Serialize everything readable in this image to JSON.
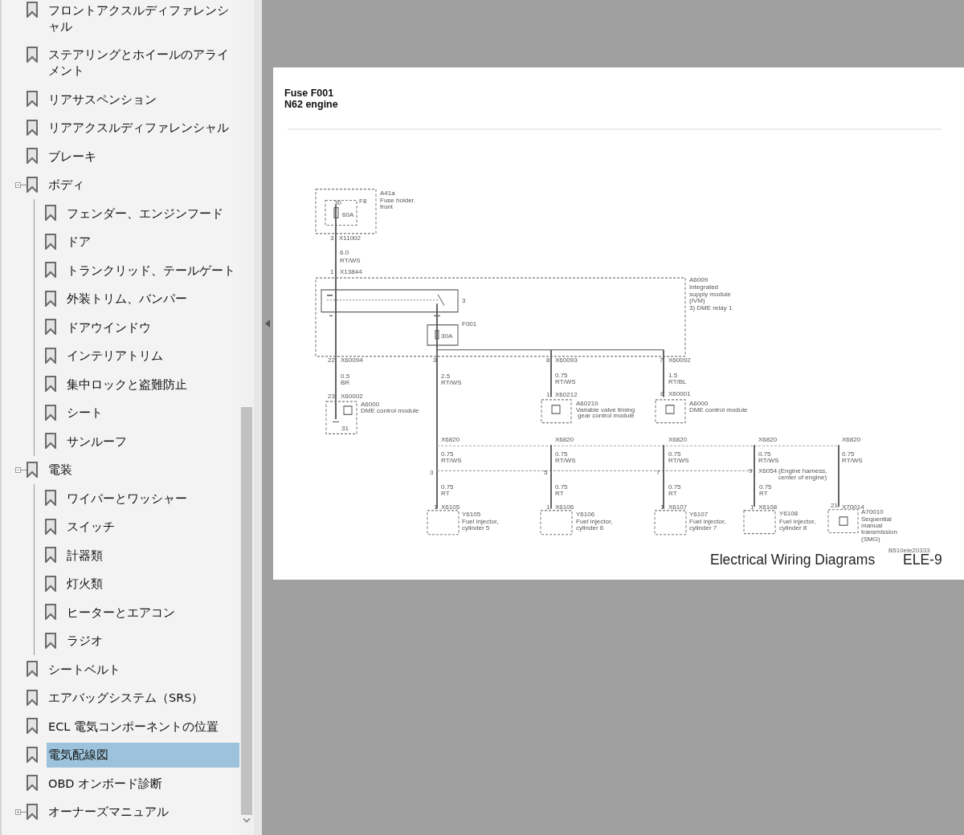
{
  "sidebar": {
    "items": [
      {
        "label": "フロントアクスルディファレンシャル",
        "selected": false
      },
      {
        "label": "ステアリングとホイールのアライメント",
        "selected": false
      },
      {
        "label": "リアサスペンション",
        "selected": false
      },
      {
        "label": "リアアクスルディファレンシャル",
        "selected": false
      },
      {
        "label": "ブレーキ",
        "selected": false
      },
      {
        "label": "ボディ",
        "selected": false,
        "expanded": true,
        "children": [
          {
            "label": "フェンダー、エンジンフード",
            "selected": false
          },
          {
            "label": "ドア",
            "selected": false
          },
          {
            "label": "トランクリッド、テールゲート",
            "selected": false
          },
          {
            "label": "外装トリム、バンパー",
            "selected": false
          },
          {
            "label": "ドアウインドウ",
            "selected": false
          },
          {
            "label": "インテリアトリム",
            "selected": false
          },
          {
            "label": "集中ロックと盗難防止",
            "selected": false
          },
          {
            "label": "シート",
            "selected": false
          },
          {
            "label": "サンルーフ",
            "selected": false
          }
        ]
      },
      {
        "label": "電装",
        "selected": false,
        "expanded": true,
        "children": [
          {
            "label": "ワイパーとワッシャー",
            "selected": false
          },
          {
            "label": "スイッチ",
            "selected": false
          },
          {
            "label": "計器類",
            "selected": false
          },
          {
            "label": "灯火類",
            "selected": false
          },
          {
            "label": "ヒーターとエアコン",
            "selected": false
          },
          {
            "label": "ラジオ",
            "selected": false
          }
        ]
      },
      {
        "label": "シートベルト",
        "selected": false
      },
      {
        "label": "エアバッグシステム（SRS）",
        "selected": false
      },
      {
        "label": "ECL 電気コンポーネントの位置",
        "selected": false
      },
      {
        "label": "電気配線図",
        "selected": true
      },
      {
        "label": "OBD オンボード診断",
        "selected": false
      },
      {
        "label": "オーナーズマニュアル",
        "selected": false,
        "expanded": false
      }
    ]
  },
  "page": {
    "title_lines": [
      "Fuse F001",
      "N62 engine"
    ],
    "labels": [
      "A41a",
      "Fuse holder.",
      "front",
      "30",
      "F8",
      "60A",
      "3",
      "X11002",
      "6.0",
      "RT/WS",
      "1",
      "X13844",
      "A6009",
      "Integrated",
      "supply module",
      "(IVM)",
      "3) DME relay 1",
      "3",
      "F001",
      "30A",
      "22",
      "X60094",
      "3",
      "8",
      "X60093",
      "7",
      "X60092",
      "0.5",
      "BR",
      "2.5",
      "RT/WS",
      "0.75",
      "RT/WS",
      "1.5",
      "RT/BL",
      "23",
      "X60002",
      "A6000",
      "DME control module",
      "31",
      "1",
      "X60212",
      "A60210",
      "Variable valve timing",
      "gear control module",
      "8",
      "X60001",
      "A6000",
      "DME control module",
      "X6820",
      "X6820",
      "X6820",
      "X6820",
      "X6820",
      "0.75",
      "0.75",
      "0.75",
      "0.75",
      "0.75",
      "RT/WS",
      "RT/WS",
      "RT/WS",
      "RT/WS",
      "RT/WS",
      "3",
      "5",
      "7",
      "9",
      "X6054",
      "(Engine harness,",
      "center of engine)",
      "0.75",
      "0.75",
      "0.75",
      "0.75",
      "RT",
      "RT",
      "RT",
      "RT",
      "1",
      "X6105",
      "1",
      "X6106",
      "1",
      "X6107",
      "1",
      "X6108",
      "21",
      "X70014",
      "Y6105",
      "Y6106",
      "Y6107",
      "Y6108",
      "A70010",
      "Fuel injector,",
      "Fuel injector,",
      "Fuel injector,",
      "Fuel injector,",
      "cylinder 5",
      "cylinder 6",
      "cylinder 7",
      "cylinder 8",
      "Sequential",
      "manual",
      "transmission",
      "(SMG)"
    ],
    "drawing_code": "B510ele20333",
    "footer": "Electrical Wiring Diagrams",
    "page_number": "ELE-9"
  }
}
